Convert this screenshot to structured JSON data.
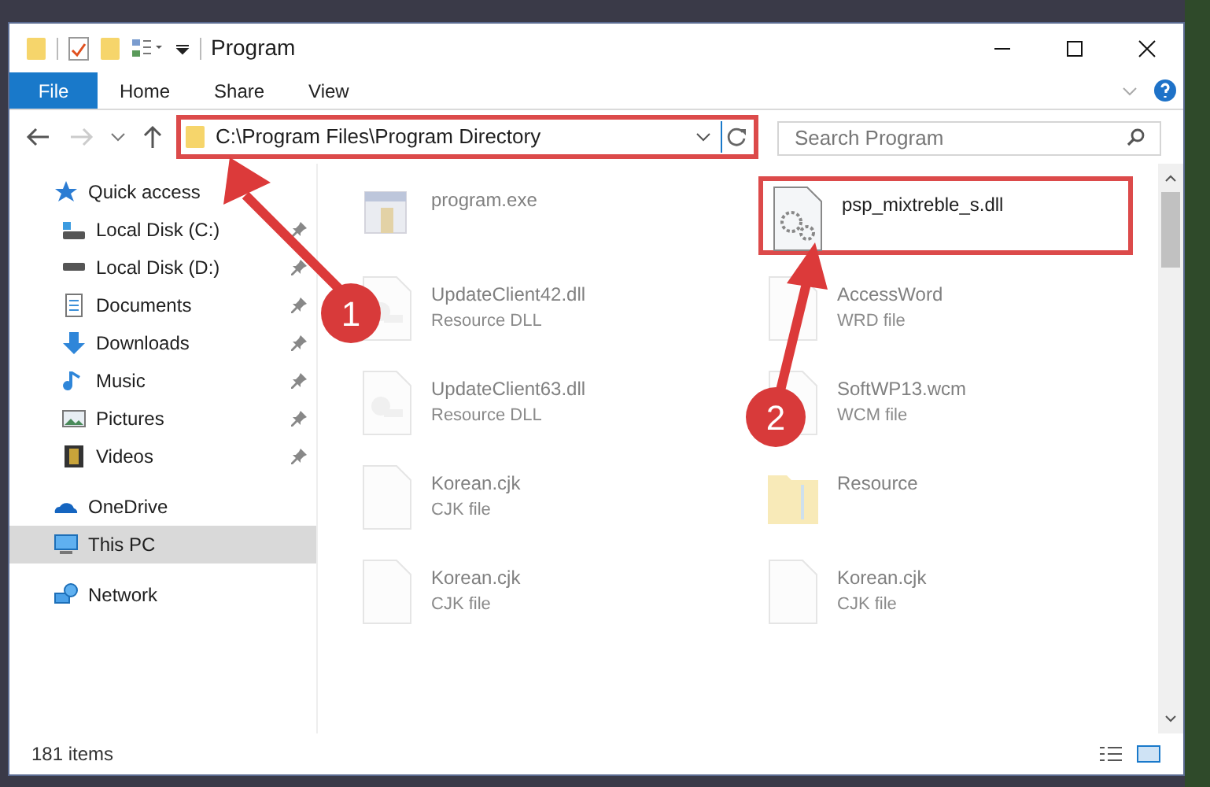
{
  "window": {
    "title": "Program"
  },
  "ribbon": {
    "tabs": [
      {
        "label": "File",
        "selected": true
      },
      {
        "label": "Home",
        "selected": false
      },
      {
        "label": "Share",
        "selected": false
      },
      {
        "label": "View",
        "selected": false
      }
    ]
  },
  "address_bar": {
    "path": "C:\\Program Files\\Program Directory"
  },
  "search": {
    "placeholder": "Search Program"
  },
  "sidebar": {
    "items": [
      {
        "label": "Quick access",
        "kind": "star",
        "pinned": false,
        "selected": false
      },
      {
        "label": "Local Disk (C:)",
        "kind": "disk-c",
        "pinned": true,
        "selected": false
      },
      {
        "label": "Local Disk (D:)",
        "kind": "disk",
        "pinned": true,
        "selected": false
      },
      {
        "label": "Documents",
        "kind": "docs",
        "pinned": true,
        "selected": false
      },
      {
        "label": "Downloads",
        "kind": "download",
        "pinned": true,
        "selected": false
      },
      {
        "label": "Music",
        "kind": "music",
        "pinned": true,
        "selected": false
      },
      {
        "label": "Pictures",
        "kind": "pictures",
        "pinned": true,
        "selected": false
      },
      {
        "label": "Videos",
        "kind": "videos",
        "pinned": true,
        "selected": false
      },
      {
        "label": "OneDrive",
        "kind": "cloud",
        "pinned": false,
        "selected": false
      },
      {
        "label": "This PC",
        "kind": "pc",
        "pinned": false,
        "selected": true
      },
      {
        "label": "Network",
        "kind": "network",
        "pinned": false,
        "selected": false
      }
    ]
  },
  "files": [
    {
      "name": "program.exe",
      "kind": "exe",
      "highlighted": false
    },
    {
      "name": "psp_mixtreble_s.dll",
      "kind": "dll",
      "highlighted": true
    },
    {
      "name": "UpdateClient42.dll",
      "type": "Resource DLL",
      "kind": "key",
      "highlighted": false
    },
    {
      "name": "AccessWord",
      "type": "WRD file",
      "kind": "blank",
      "highlighted": false
    },
    {
      "name": "UpdateClient63.dll",
      "type": "Resource DLL",
      "kind": "key",
      "highlighted": false
    },
    {
      "name": "SoftWP13.wcm",
      "type": "WCM file",
      "kind": "blank",
      "highlighted": false
    },
    {
      "name": "Korean.cjk",
      "type": "CJK file",
      "kind": "blank",
      "highlighted": false
    },
    {
      "name": "Resource",
      "kind": "folder",
      "highlighted": false
    },
    {
      "name": "Korean.cjk",
      "type": "CJK file",
      "kind": "blank",
      "highlighted": false
    },
    {
      "name": "Korean.cjk",
      "type": "CJK file",
      "kind": "blank",
      "highlighted": false
    }
  ],
  "status_bar": {
    "count": "181 items"
  },
  "annotations": [
    {
      "label": "1"
    },
    {
      "label": "2"
    }
  ]
}
